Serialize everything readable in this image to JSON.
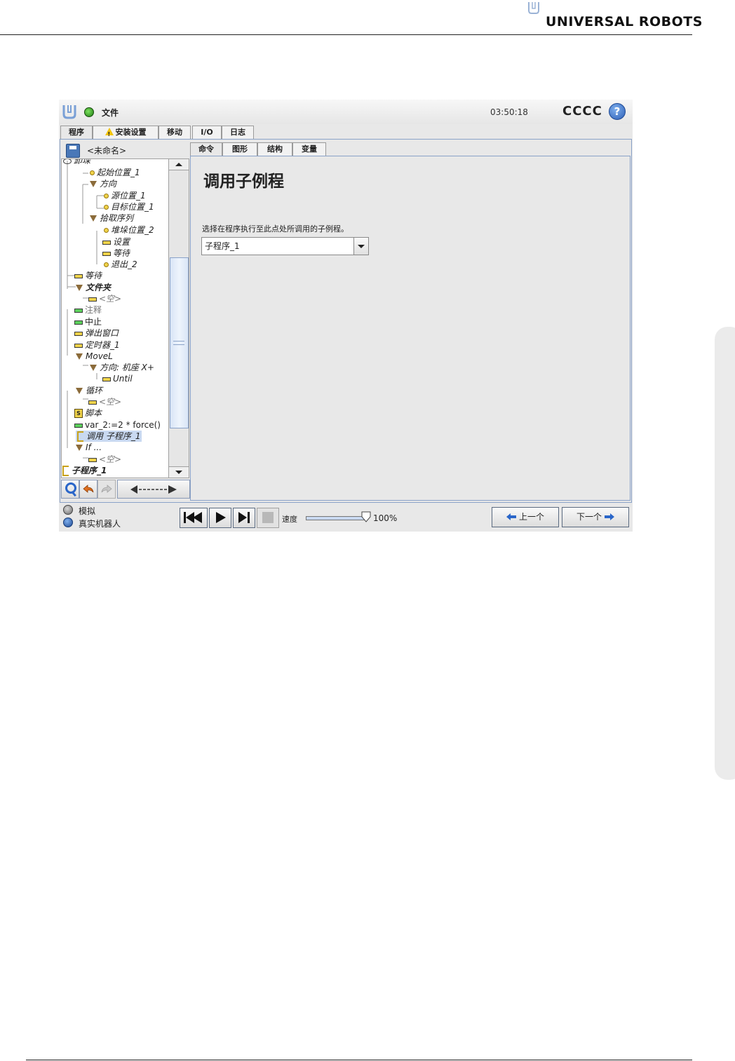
{
  "document": {
    "brand": "UNIVERSAL ROBOTS",
    "logo_icon": "ur-logo-icon"
  },
  "app": {
    "file_menu": "文件",
    "clock": "03:50:18",
    "robot_name": "CCCC",
    "help_label": "?",
    "main_tabs": [
      "程序",
      "安装设置",
      "移动",
      "I/O",
      "日志"
    ],
    "program_name": "<未命名>",
    "sub_tabs": [
      "命令",
      "图形",
      "结构",
      "变量"
    ]
  },
  "tree": {
    "nodes": [
      {
        "label": "卸垛",
        "icon": "robot-icon"
      },
      {
        "label": "起始位置_1",
        "icon": "waypoint-icon"
      },
      {
        "label": "方向",
        "icon": "folder-triangle-icon"
      },
      {
        "label": "源位置_1",
        "icon": "waypoint-icon"
      },
      {
        "label": "目标位置_1",
        "icon": "waypoint-icon"
      },
      {
        "label": "拾取序列",
        "icon": "folder-triangle-icon"
      },
      {
        "label": "堆垛位置_2",
        "icon": "waypoint-icon"
      },
      {
        "label": "设置",
        "icon": "command-bar-icon"
      },
      {
        "label": "等待",
        "icon": "command-bar-icon"
      },
      {
        "label": "退出_2",
        "icon": "waypoint-icon"
      },
      {
        "label": "等待",
        "icon": "command-bar-icon"
      },
      {
        "label": "文件夹",
        "icon": "folder-triangle-icon"
      },
      {
        "label": "<空>",
        "icon": "command-bar-icon"
      },
      {
        "label": "注释",
        "icon": "command-bar-icon"
      },
      {
        "label": "中止",
        "icon": "command-bar-icon"
      },
      {
        "label": "弹出窗口",
        "icon": "command-bar-icon"
      },
      {
        "label": "定时器_1",
        "icon": "command-bar-icon"
      },
      {
        "label": "MoveL",
        "icon": "folder-triangle-icon"
      },
      {
        "label": "方向: 机座 X+",
        "icon": "folder-triangle-icon"
      },
      {
        "label": "Until",
        "icon": "command-bar-icon"
      },
      {
        "label": "循环",
        "icon": "folder-triangle-icon"
      },
      {
        "label": "<空>",
        "icon": "command-bar-icon"
      },
      {
        "label": "脚本",
        "icon": "script-icon"
      },
      {
        "label": "var_2:=2 * force()",
        "icon": "command-bar-icon"
      },
      {
        "label": "调用 子程序_1",
        "icon": "subprogram-icon"
      },
      {
        "label": "If ...",
        "icon": "folder-triangle-icon"
      },
      {
        "label": "<空>",
        "icon": "command-bar-icon"
      },
      {
        "label": "子程序_1",
        "icon": "subprogram-icon"
      }
    ]
  },
  "command": {
    "title": "调用子例程",
    "description": "选择在程序执行至此点处所调用的子例程。",
    "selected_subprogram": "子程序_1"
  },
  "bottom": {
    "mode_simulation": "模拟",
    "mode_real_robot": "真实机器人",
    "speed_label": "速度",
    "speed_value": "100%",
    "speed_fraction": 1.0,
    "prev_label": "上一个",
    "next_label": "下一个"
  }
}
